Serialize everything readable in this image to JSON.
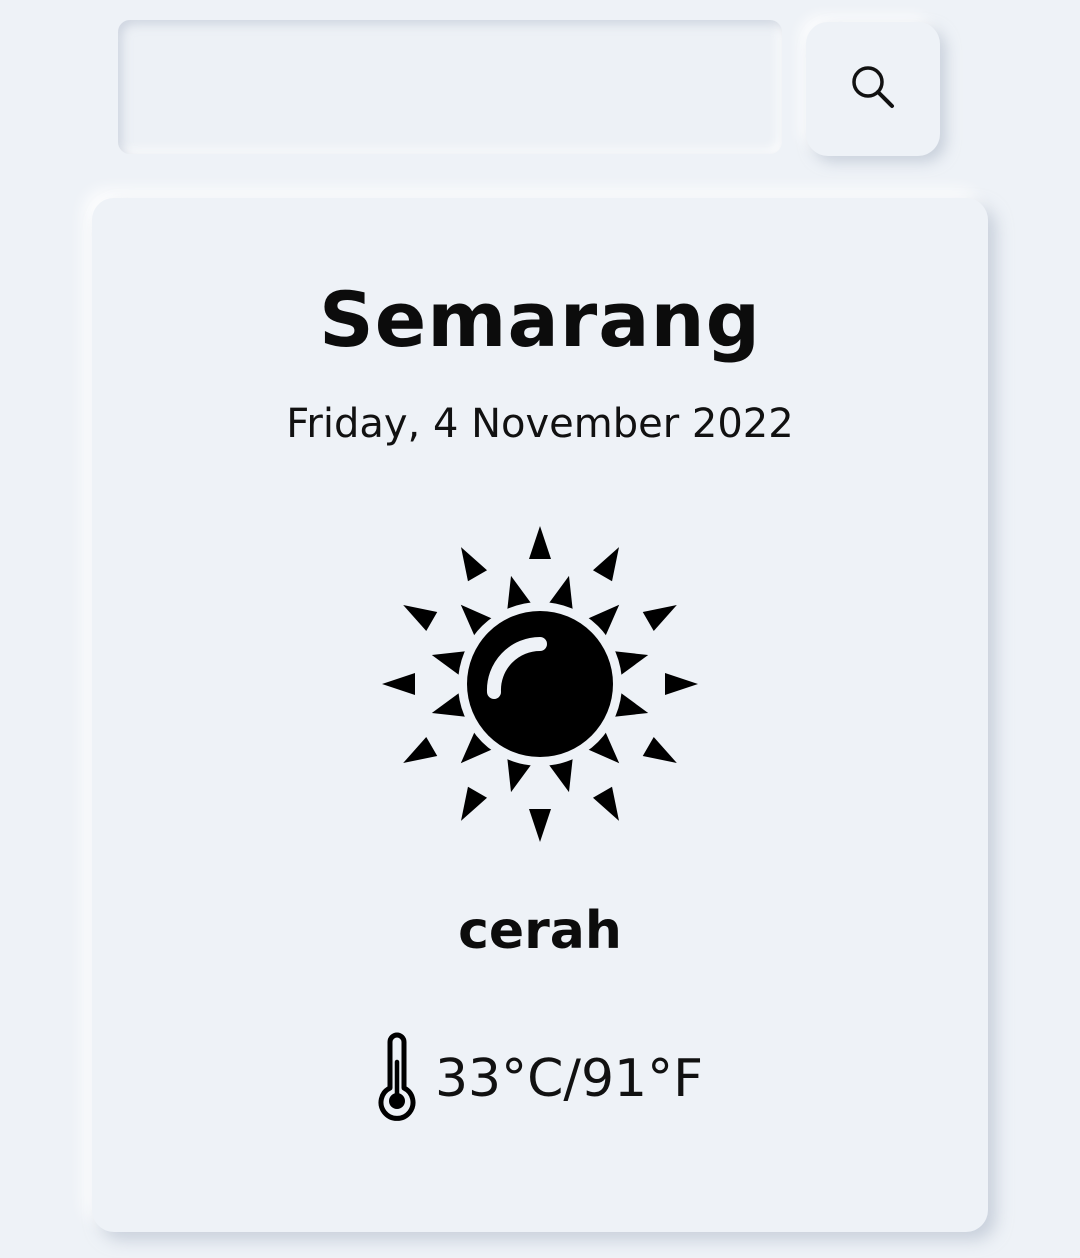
{
  "search": {
    "value": "",
    "placeholder": "",
    "button_icon": "search-icon"
  },
  "weather": {
    "city": "Semarang",
    "date": "Friday, 4 November 2022",
    "icon": "sun-icon",
    "condition": "cerah",
    "temperature_icon": "thermometer-icon",
    "temperature": "33°C/91°F"
  }
}
